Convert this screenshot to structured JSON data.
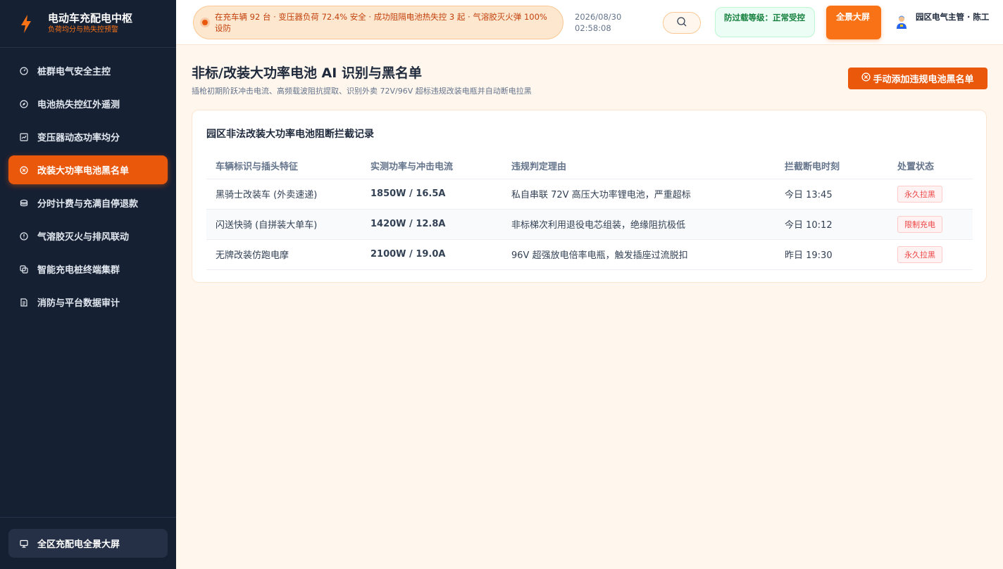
{
  "brand": {
    "title": "电动车充配电中枢",
    "subtitle": "负荷均分与热失控预警"
  },
  "sidebar": {
    "items": [
      {
        "label": "桩群电气安全主控",
        "icon": "gauge-icon",
        "active": false
      },
      {
        "label": "电池热失控红外遥测",
        "icon": "compass-icon",
        "active": false
      },
      {
        "label": "变压器动态功率均分",
        "icon": "chart-icon",
        "active": false
      },
      {
        "label": "改装大功率电池黑名单",
        "icon": "ban-circle-icon",
        "active": true
      },
      {
        "label": "分时计费与充满自停退款",
        "icon": "coins-icon",
        "active": false
      },
      {
        "label": "气溶胶灭火与排风联动",
        "icon": "alert-circle-icon",
        "active": false
      },
      {
        "label": "智能充电桩终端集群",
        "icon": "layers-icon",
        "active": false
      },
      {
        "label": "消防与平台数据审计",
        "icon": "document-icon",
        "active": false
      }
    ],
    "footer_label": "全区充配电全景大屏"
  },
  "header": {
    "ticker": "在充车辆 92 台 · 变压器负荷 72.4% 安全 · 成功阻隔电池热失控 3 起 · 气溶胶灭火弹 100% 设防",
    "date": "2026/08/30",
    "time": "02:58:08",
    "level_badge": "防过载等级：正常受控",
    "fullscreen_label": "全景大屏",
    "user_name": "园区电气主管 · 陈工"
  },
  "main": {
    "title": "非标/改装大功率电池 AI 识别与黑名单",
    "subtitle": "插枪初期阶跃冲击电流、高频载波阻抗提取、识别外卖 72V/96V 超标违规改装电瓶并自动断电拉黑",
    "add_button": "手动添加违规电池黑名单",
    "card_title": "园区非法改装大功率电池阻断拦截记录",
    "columns": [
      "车辆标识与插头特征",
      "实测功率与冲击电流",
      "违规判定理由",
      "拦截断电时刻",
      "处置状态"
    ],
    "rows": [
      {
        "vehicle": "黑骑士改装车 (外卖速递)",
        "power": "1850W / 16.5A",
        "reason": "私自串联 72V 高压大功率锂电池，严重超标",
        "time": "今日 13:45",
        "status": "永久拉黑"
      },
      {
        "vehicle": "闪送快骑 (自拼装大单车)",
        "power": "1420W / 12.8A",
        "reason": "非标梯次利用退役电芯组装，绝缘阻抗极低",
        "time": "今日 10:12",
        "status": "限制充电"
      },
      {
        "vehicle": "无牌改装仿跑电摩",
        "power": "2100W / 19.0A",
        "reason": "96V 超强放电倍率电瓶，触发插座过流脱扣",
        "time": "昨日 19:30",
        "status": "永久拉黑"
      }
    ]
  },
  "colors": {
    "accent": "#ea580c",
    "sidebar_bg": "#162033",
    "page_bg": "#fff6ee",
    "danger": "#ef4444",
    "safe": "#15803d"
  }
}
